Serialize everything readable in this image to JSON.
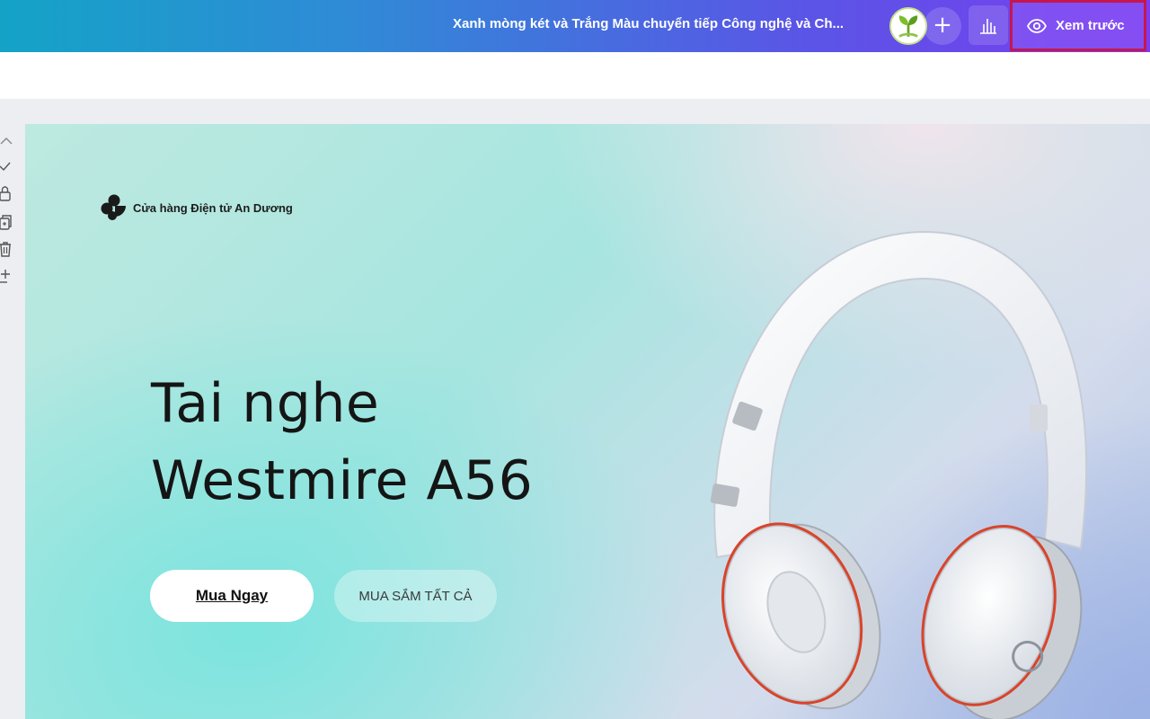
{
  "header": {
    "doc_title": "Xanh mòng két và Trắng Màu chuyển tiếp Công nghệ và Ch...",
    "preview_label": "Xem trước",
    "add_symbol": "+"
  },
  "left_tools": {
    "icons": [
      "chevron-up-icon",
      "check-icon",
      "lock-icon",
      "duplicate-icon",
      "trash-icon",
      "add-page-icon"
    ]
  },
  "canvas": {
    "brand_name": "Cửa hàng Điện tử An Dương",
    "headline_line1": "Tai nghe",
    "headline_line2": "Westmire A56",
    "primary_cta": "Mua Ngay",
    "secondary_cta": "MUA SẮM TẤT CẢ",
    "product_image": "white over-ear headphones"
  },
  "colors": {
    "header_gradient_start": "#14a3c7",
    "header_gradient_end": "#7a3cf0",
    "preview_highlight_border": "#c5174f"
  }
}
